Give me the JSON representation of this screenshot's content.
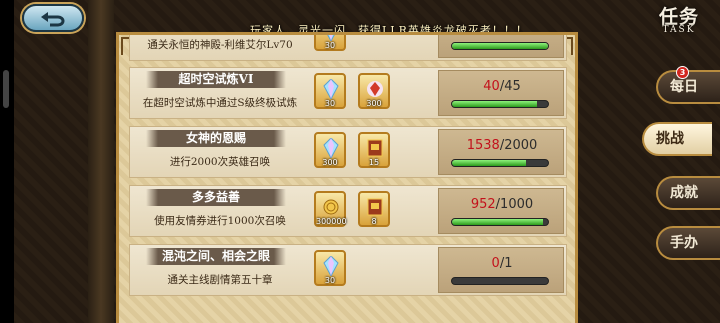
{
  "marquee": "玩家人、灵光一闪、获得LLR英雄炎龙破灭者！！！",
  "header": {
    "title": "任务",
    "subtitle": "TASK"
  },
  "tasks": [
    {
      "title": "",
      "desc": "通关永恒的神殿-利维艾尔Lv70",
      "rewards": [
        {
          "icon": "diamond-icon",
          "qty": "30"
        }
      ],
      "current": "",
      "total": "",
      "progress": 1.0
    },
    {
      "title": "超时空试炼VI",
      "desc": "在超时空试炼中通过S级终极试炼",
      "rewards": [
        {
          "icon": "diamond-icon",
          "qty": "30"
        },
        {
          "icon": "red-crystal-icon",
          "qty": "300"
        }
      ],
      "current": "40",
      "total": "/45",
      "progress": 0.89
    },
    {
      "title": "女神的恩赐",
      "desc": "进行2000次英雄召唤",
      "rewards": [
        {
          "icon": "diamond-icon",
          "qty": "300"
        },
        {
          "icon": "summon-ticket-icon",
          "qty": "15"
        }
      ],
      "current": "1538",
      "total": "/2000",
      "progress": 0.77
    },
    {
      "title": "多多益善",
      "desc": "使用友情券进行1000次召唤",
      "rewards": [
        {
          "icon": "coin-icon",
          "qty": "300000"
        },
        {
          "icon": "summon-ticket-icon",
          "qty": "8"
        }
      ],
      "current": "952",
      "total": "/1000",
      "progress": 0.95
    },
    {
      "title": "混沌之间、相会之眼",
      "desc": "通关主线剧情第五十章",
      "rewards": [
        {
          "icon": "diamond-icon",
          "qty": "30"
        }
      ],
      "current": "0",
      "total": "/1",
      "progress": 0.0
    }
  ],
  "tabs": [
    {
      "label": "每日",
      "badge": "3",
      "active": false
    },
    {
      "label": "挑战",
      "badge": "",
      "active": true
    },
    {
      "label": "成就",
      "badge": "",
      "active": false
    },
    {
      "label": "手办",
      "badge": "",
      "active": false
    }
  ],
  "colors": {
    "progress_fill": "#3fb12a",
    "current_value": "#c3121c",
    "tab_border": "#b88c3f"
  }
}
